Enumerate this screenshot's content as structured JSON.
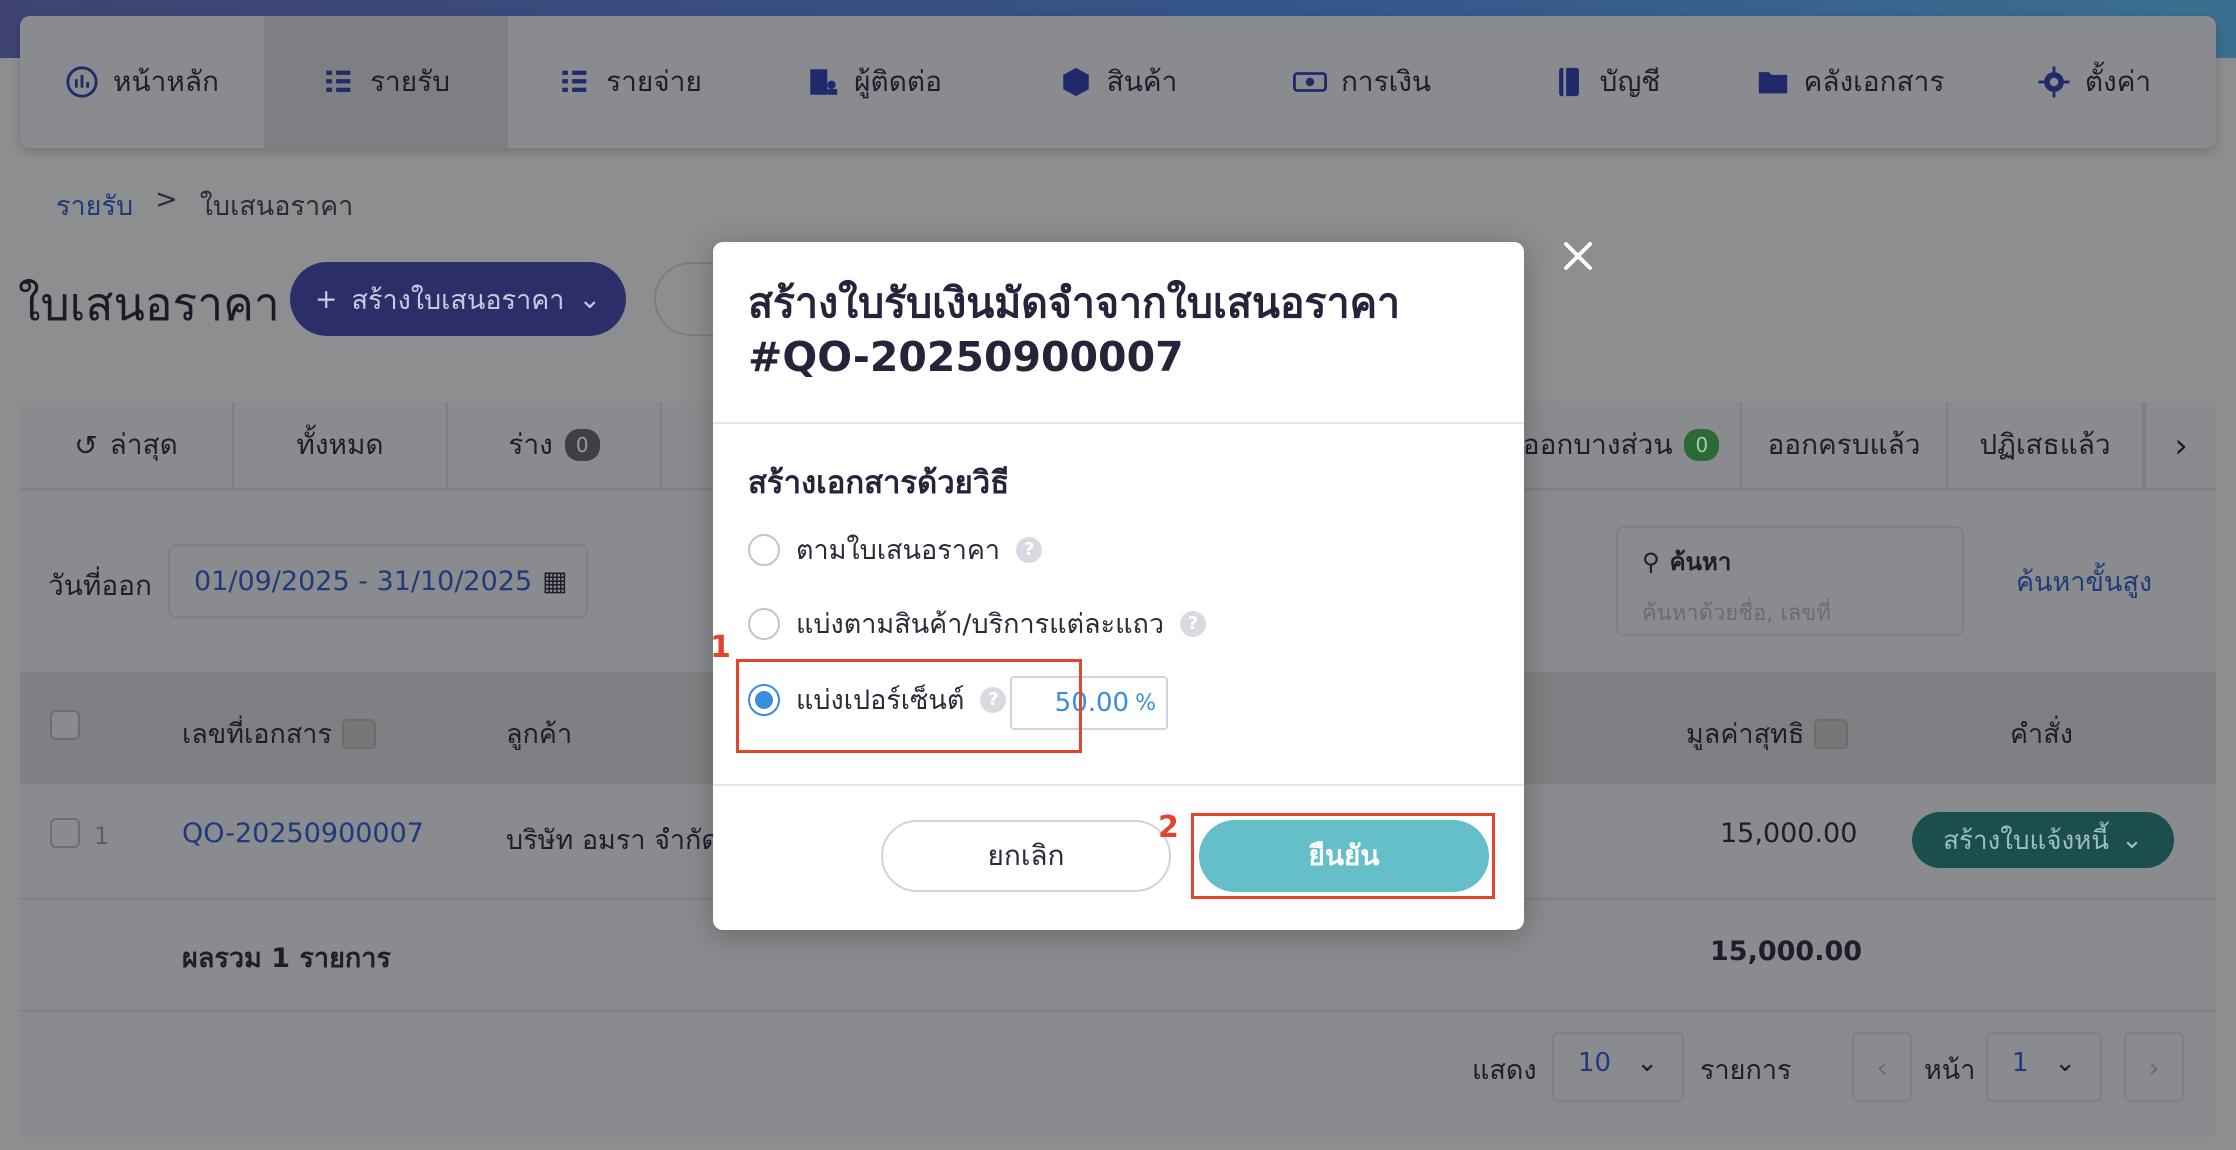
{
  "nav": {
    "items": [
      {
        "label": "หน้าหลัก",
        "icon": "dashboard-icon"
      },
      {
        "label": "รายรับ",
        "icon": "income-icon",
        "active": true
      },
      {
        "label": "รายจ่าย",
        "icon": "expense-icon"
      },
      {
        "label": "ผู้ติดต่อ",
        "icon": "contacts-icon"
      },
      {
        "label": "สินค้า",
        "icon": "box-icon"
      },
      {
        "label": "การเงิน",
        "icon": "money-icon"
      },
      {
        "label": "บัญชี",
        "icon": "book-icon"
      },
      {
        "label": "คลังเอกสาร",
        "icon": "folder-icon"
      },
      {
        "label": "ตั้งค่า",
        "icon": "gear-icon"
      }
    ]
  },
  "breadcrumb": {
    "parent": "รายรับ",
    "separator": ">",
    "current": "ใบเสนอราคา"
  },
  "page": {
    "title": "ใบเสนอราคา",
    "create_label": "สร้างใบเสนอราคา"
  },
  "tabs": {
    "latest": "ล่าสุด",
    "all": "ทั้งหมด",
    "draft": "ร่าง",
    "draft_count": "0",
    "partial": "ออกบางส่วน",
    "partial_count": "0",
    "fully_issued": "ออกครบแล้ว",
    "rejected": "ปฏิเสธแล้ว"
  },
  "filter": {
    "date_label": "วันที่ออก",
    "date_range": "01/09/2025 - 31/10/2025",
    "search_label": "ค้นหา",
    "search_placeholder": "ค้นหาด้วยชื่อ, เลขที่",
    "advanced": "ค้นหาขั้นสูง"
  },
  "table": {
    "headers": {
      "doc_no": "เลขที่เอกสาร",
      "customer": "ลูกค้า",
      "net": "มูลค่าสุทธิ",
      "action": "คำสั่ง"
    },
    "rows": [
      {
        "index": "1",
        "doc_no": "QO-20250900007",
        "customer": "บริษัท อมรา จำกัด",
        "net": "15,000.00",
        "action": "สร้างใบแจ้งหนี้"
      }
    ],
    "footer": {
      "label": "ผลรวม 1 รายการ",
      "total": "15,000.00"
    }
  },
  "pagination": {
    "show": "แสดง",
    "per_page": "10",
    "items": "รายการ",
    "page_label": "หน้า",
    "page": "1"
  },
  "modal": {
    "title": "สร้างใบรับเงินมัดจำจากใบเสนอราคา #QO-20250900007",
    "method_label": "สร้างเอกสารด้วยวิธี",
    "options": [
      {
        "label": "ตามใบเสนอราคา",
        "checked": false
      },
      {
        "label": "แบ่งตามสินค้า/บริการแต่ละแถว",
        "checked": false
      },
      {
        "label": "แบ่งเปอร์เซ็นต์",
        "checked": true
      }
    ],
    "percent_value": "50.00",
    "percent_unit": "%",
    "cancel": "ยกเลิก",
    "confirm": "ยืนยัน",
    "annotation_1": "1",
    "annotation_2": "2",
    "highlight_color": "#e2452e"
  }
}
